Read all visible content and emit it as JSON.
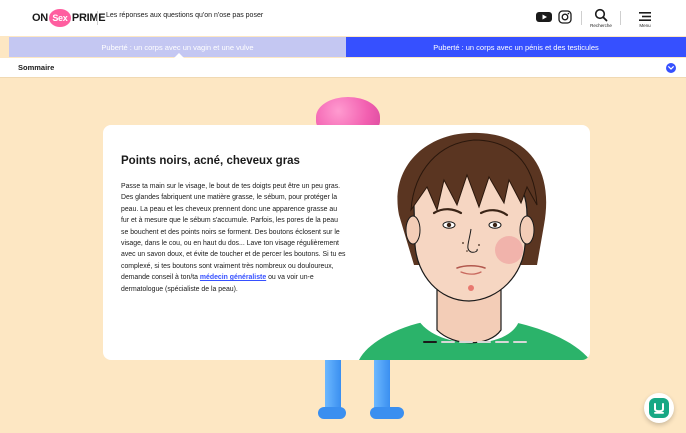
{
  "header": {
    "logo": {
      "on": "ON",
      "sex": "Sex",
      "prime": "PRIME"
    },
    "tagline": "Les réponses aux questions qu'on n'ose pas poser",
    "search_label": "Recherche",
    "menu_label": "Menu",
    "icons": [
      "youtube-icon",
      "instagram-icon",
      "search-icon",
      "menu-icon"
    ]
  },
  "tabs": [
    {
      "label": "Puberté : un corps avec un vagin et une vulve",
      "selected": true
    },
    {
      "label": "Puberté : un corps avec un pénis et des testicules",
      "selected": false
    }
  ],
  "sommaire": {
    "label": "Sommaire"
  },
  "card": {
    "title": "Points noirs, acné, cheveux gras",
    "text_before_link": "Passe ta main sur le visage, le bout de tes doigts peut être un peu gras. Des glandes fabriquent une matière grasse, le sébum, pour protéger la peau. La peau et les cheveux prennent donc une apparence grasse au fur et à mesure que le sébum s'accumule. Parfois, les pores de la peau se bouchent et des points noirs se forment. Des boutons éclosent sur le visage, dans le cou, ou en haut du dos... Lave ton visage régulièrement avec un savon doux, et évite de toucher et de percer les boutons. Si tu es complexé, si tes boutons sont vraiment très nombreux ou douloureux, demande conseil à ton/ta ",
    "link_text": "médecin généraliste",
    "text_after_link": " ou va voir un-e dermatologue (spécialiste de la peau).",
    "slides_total": 6,
    "slide_active": 1
  },
  "colors": {
    "background": "#fde7c3",
    "tab_selected": "#c4c7f2",
    "tab_other": "#3650ff",
    "link": "#3650ff",
    "chat": "#17a884"
  }
}
